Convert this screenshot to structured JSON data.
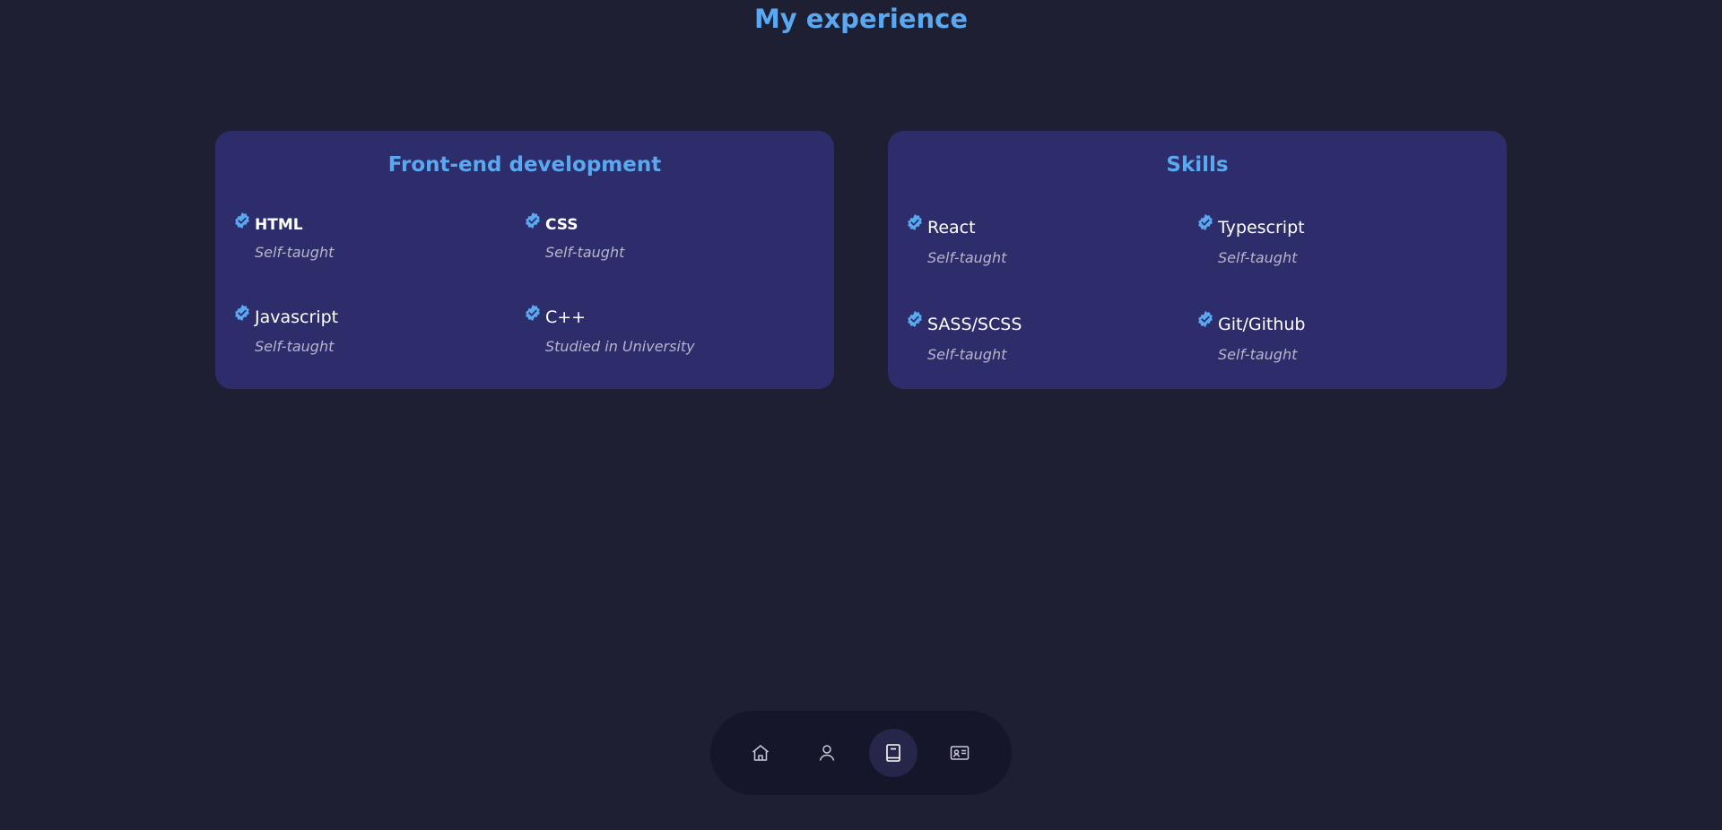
{
  "header": {
    "title": "My experience"
  },
  "colors": {
    "background": "#1f1f33",
    "card": "#2d2d6b",
    "accent": "#5aa9f0",
    "nav_bg": "#16162a"
  },
  "frontend": {
    "title": "Front-end development",
    "items": [
      {
        "name": "HTML",
        "level": "Self-taught"
      },
      {
        "name": "CSS",
        "level": "Self-taught"
      },
      {
        "name": "Javascript",
        "level": "Self-taught"
      },
      {
        "name": "C++",
        "level": "Studied in University"
      }
    ]
  },
  "skills": {
    "title": "Skills",
    "items": [
      {
        "name": "React",
        "level": "Self-taught"
      },
      {
        "name": "Typescript",
        "level": "Self-taught"
      },
      {
        "name": "SASS/SCSS",
        "level": "Self-taught"
      },
      {
        "name": "Git/Github",
        "level": "Self-taught"
      }
    ]
  },
  "nav": {
    "items": [
      {
        "icon": "home-icon",
        "active": false
      },
      {
        "icon": "user-icon",
        "active": false
      },
      {
        "icon": "book-icon",
        "active": true
      },
      {
        "icon": "contact-card-icon",
        "active": false
      }
    ]
  }
}
